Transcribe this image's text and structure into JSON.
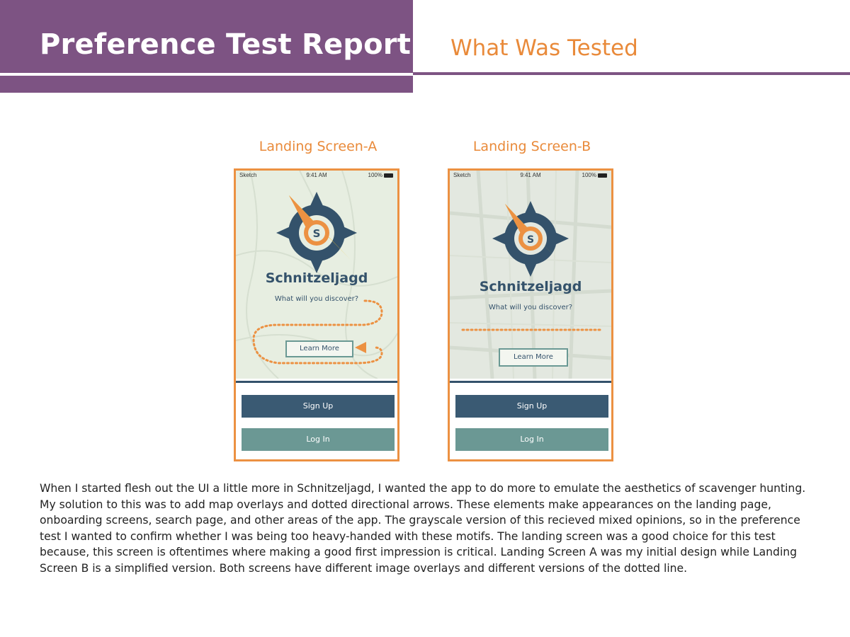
{
  "header": {
    "title": "Preference Test Report:",
    "subtitle": "What Was Tested",
    "colors": {
      "band": "#7d5383",
      "accent": "#e98a3a"
    }
  },
  "screens": [
    {
      "label": "Landing Screen-A",
      "status": {
        "carrier": "Sketch",
        "time": "9:41 AM",
        "battery": "100%"
      },
      "app_title": "Schnitzeljagd",
      "tagline": "What will you discover?",
      "learn_more": "Learn More",
      "sign_up": "Sign Up",
      "log_in": "Log In",
      "icons": [
        "compass-logo-icon",
        "wifi-icon",
        "battery-icon",
        "bluetooth-icon"
      ]
    },
    {
      "label": "Landing Screen-B",
      "status": {
        "carrier": "Sketch",
        "time": "9:41 AM",
        "battery": "100%"
      },
      "app_title": "Schnitzeljagd",
      "tagline": "What will you discover?",
      "learn_more": "Learn More",
      "sign_up": "Sign Up",
      "log_in": "Log In",
      "icons": [
        "compass-logo-icon",
        "wifi-icon",
        "battery-icon",
        "bluetooth-icon"
      ]
    }
  ],
  "body": {
    "paragraph": "When I started flesh out the UI a little more in Schnitzeljagd, I wanted the app to do more to emulate the aesthetics of scavenger hunting. My solution to this was to add map overlays and dotted directional arrows. These elements make appearances on the landing page, onboarding screens, search page, and other areas of the app. The grayscale version of this recieved mixed opinions, so in the preference test I wanted to confirm whether I was being too heavy-handed with these motifs. The landing screen was a good choice for this test because, this screen is oftentimes where making a good first impression is critical. Landing Screen A was my initial design while Landing Screen B is a simplified version. Both screens have different image overlays and different versions of the dotted line."
  }
}
